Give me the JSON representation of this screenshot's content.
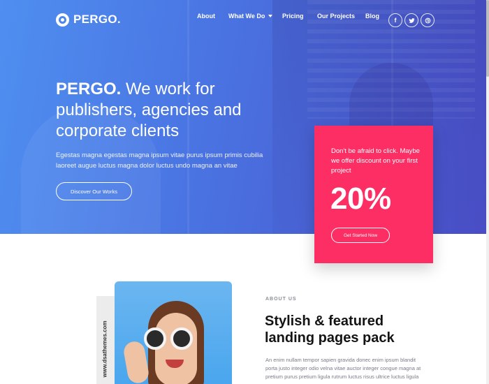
{
  "brand": {
    "logo_text": "PERGO."
  },
  "nav": {
    "items": [
      {
        "label": "About"
      },
      {
        "label": "What We Do",
        "has_dropdown": true
      },
      {
        "label": "Pricing"
      },
      {
        "label": "Our Projects"
      },
      {
        "label": "Blog"
      }
    ],
    "socials": [
      {
        "icon": "facebook-icon",
        "glyph": "f"
      },
      {
        "icon": "twitter-icon"
      },
      {
        "icon": "dribbble-icon"
      }
    ]
  },
  "hero": {
    "headline_bold": "PERGO.",
    "headline_rest": " We work for publishers, agencies and corporate clients",
    "subtext": "Egestas magna egestas magna ipsum vitae purus ipsum primis cubilia laoreet augue luctus magna dolor luctus undo magna an vitae",
    "cta_label": "Discover Our Works"
  },
  "promo": {
    "text": "Don't be afraid to click. Maybe we offer discount on your first project",
    "percent": "20%",
    "button_label": "Get Started Now",
    "color": "#fc2e64"
  },
  "about": {
    "side_text": "www.dsathemes.com",
    "label": "ABOUT US",
    "title": "Stylish & featured landing pages pack",
    "body": "An enim nullam tempor sapien gravida donec enim ipsum blandit porta justo integer odio velna vitae auctor integer congue magna at pretium purus pretium ligula rutrum luctus risus ultrice luctus ligula congue"
  },
  "colors": {
    "hero_gradient_start": "#4f8ff0",
    "hero_gradient_end": "#4b4fc9",
    "accent": "#fc2e64"
  }
}
